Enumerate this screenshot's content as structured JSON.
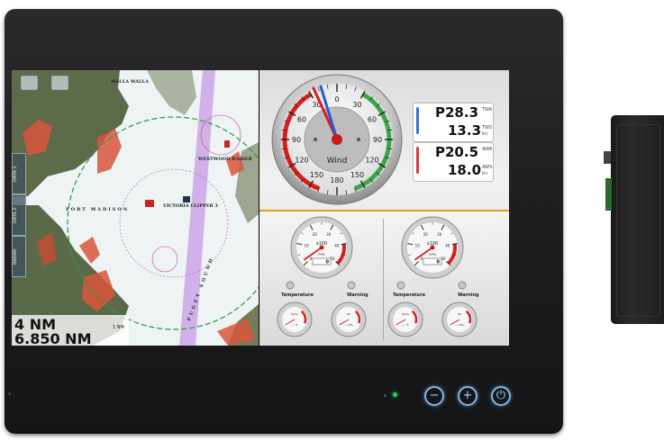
{
  "chart": {
    "scale_range": "4 NM",
    "scale_distance": "6.850 NM",
    "scale_bar": "1 NM",
    "side_tabs": [
      "DATA 1",
      "DATA 2",
      "RADAR"
    ],
    "place_labels": [
      "WALLA WALLA",
      "WESTWOOD RAIDER",
      "VICTORIA CLIPPER 3",
      "PORT MADISON",
      "PUGET SOUND"
    ]
  },
  "wind_gauge": {
    "label": "Wind",
    "ticks": [
      "0",
      "30",
      "60",
      "90",
      "120",
      "150",
      "180",
      "150",
      "120",
      "90",
      "60",
      "30"
    ]
  },
  "readouts": [
    {
      "value": "P28.3",
      "label_top": "TWA",
      "value2": "13.3",
      "label2_top": "TWS",
      "label2_bottom": "kn",
      "color": "#3a6fd8"
    },
    {
      "value": "P20.5",
      "label_top": "AWA",
      "value2": "18.0",
      "label2_top": "AWS",
      "label2_bottom": "kn",
      "color": "#d83a3a"
    }
  ],
  "engines": [
    {
      "multiplier": "x100",
      "unit": "RPM",
      "value": "0",
      "temp_label": "Temperature",
      "warning_label": "Warning",
      "small1_label": "Temp",
      "small1_unit": "°F",
      "small2_label": "Oil",
      "small2_unit": "kPa",
      "ticks": [
        "0",
        "10",
        "20",
        "30",
        "40",
        "50"
      ]
    },
    {
      "multiplier": "x100",
      "unit": "RPM",
      "value": "0",
      "temp_label": "Temperature",
      "warning_label": "Warning",
      "small1_label": "Temp",
      "small1_unit": "°F",
      "small2_label": "Oil",
      "small2_unit": "kPa",
      "ticks": [
        "0",
        "10",
        "20",
        "30",
        "40",
        "50"
      ]
    }
  ],
  "hardware": {
    "minus": "−",
    "plus": "+",
    "power": "⏻"
  },
  "colors": {
    "bezel": "#1d1d1f",
    "button_glow": "#7fb8e8",
    "led": "#2ecc40",
    "red_zone": "#d62020",
    "green_zone": "#3aa84a"
  }
}
